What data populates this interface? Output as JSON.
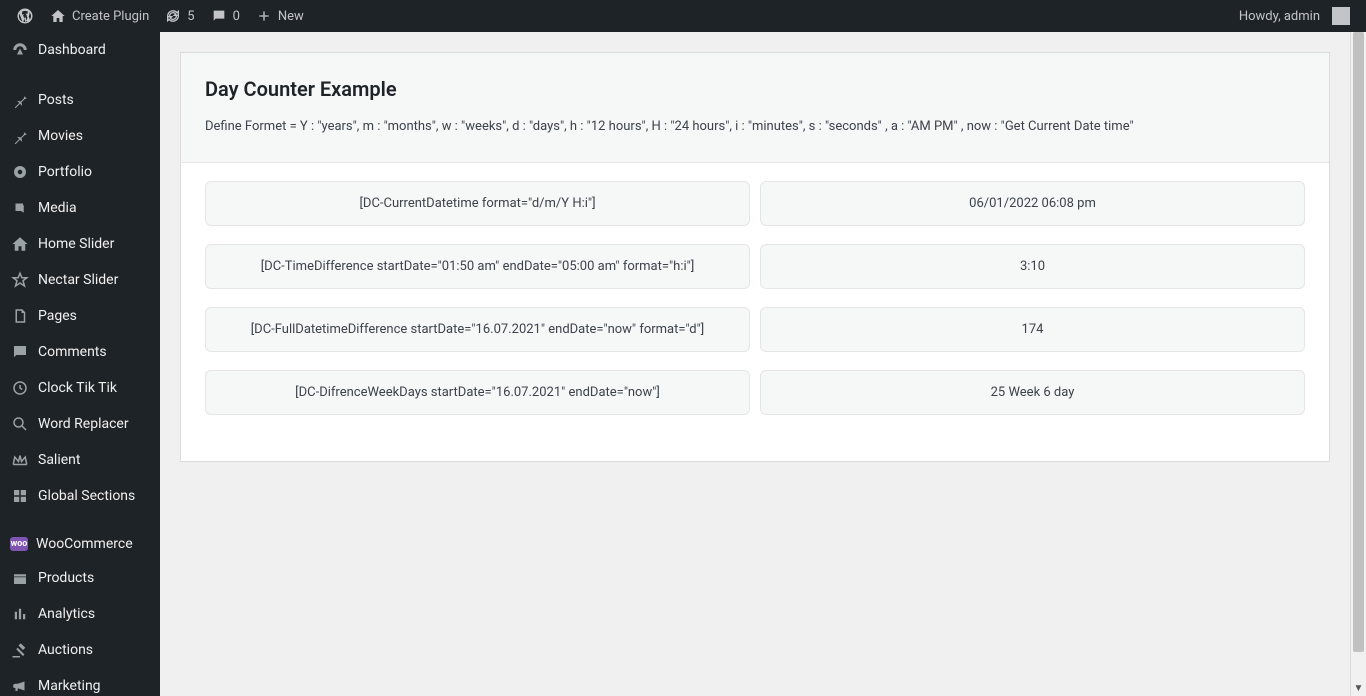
{
  "adminbar": {
    "site_name": "Create Plugin",
    "updates_count": "5",
    "comments_count": "0",
    "new_label": "New",
    "howdy": "Howdy, admin"
  },
  "sidebar": {
    "items": [
      {
        "icon": "dashboard",
        "label": "Dashboard"
      },
      {
        "icon": "pin",
        "label": "Posts"
      },
      {
        "icon": "pin",
        "label": "Movies"
      },
      {
        "icon": "portfolio",
        "label": "Portfolio"
      },
      {
        "icon": "media",
        "label": "Media"
      },
      {
        "icon": "home",
        "label": "Home Slider"
      },
      {
        "icon": "star",
        "label": "Nectar Slider"
      },
      {
        "icon": "page",
        "label": "Pages"
      },
      {
        "icon": "comment",
        "label": "Comments"
      },
      {
        "icon": "clock",
        "label": "Clock Tik Tik"
      },
      {
        "icon": "search",
        "label": "Word Replacer"
      },
      {
        "icon": "crown",
        "label": "Salient"
      },
      {
        "icon": "grid",
        "label": "Global Sections"
      },
      {
        "icon": "woo",
        "label": "WooCommerce"
      },
      {
        "icon": "box",
        "label": "Products"
      },
      {
        "icon": "chart",
        "label": "Analytics"
      },
      {
        "icon": "gavel",
        "label": "Auctions"
      },
      {
        "icon": "megaphone",
        "label": "Marketing"
      }
    ]
  },
  "page": {
    "title": "Day Counter Example",
    "subtitle": "Define Formet = Y : \"years\", m : \"months\", w : \"weeks\", d : \"days\", h : \"12 hours\", H : \"24 hours\", i : \"minutes\", s : \"seconds\" , a : \"AM PM\" , now : \"Get Current Date time\"",
    "rows": [
      {
        "code": "[DC-CurrentDatetime format=\"d/m/Y H:i\"]",
        "result": "06/01/2022 06:08 pm"
      },
      {
        "code": "[DC-TimeDifference startDate=\"01:50 am\" endDate=\"05:00 am\" format=\"h:i\"]",
        "result": "3:10"
      },
      {
        "code": "[DC-FullDatetimeDifference startDate=\"16.07.2021\" endDate=\"now\" format=\"d\"]",
        "result": "174"
      },
      {
        "code": "[DC-DifrenceWeekDays startDate=\"16.07.2021\" endDate=\"now\"]",
        "result": "25 Week 6 day"
      }
    ]
  }
}
